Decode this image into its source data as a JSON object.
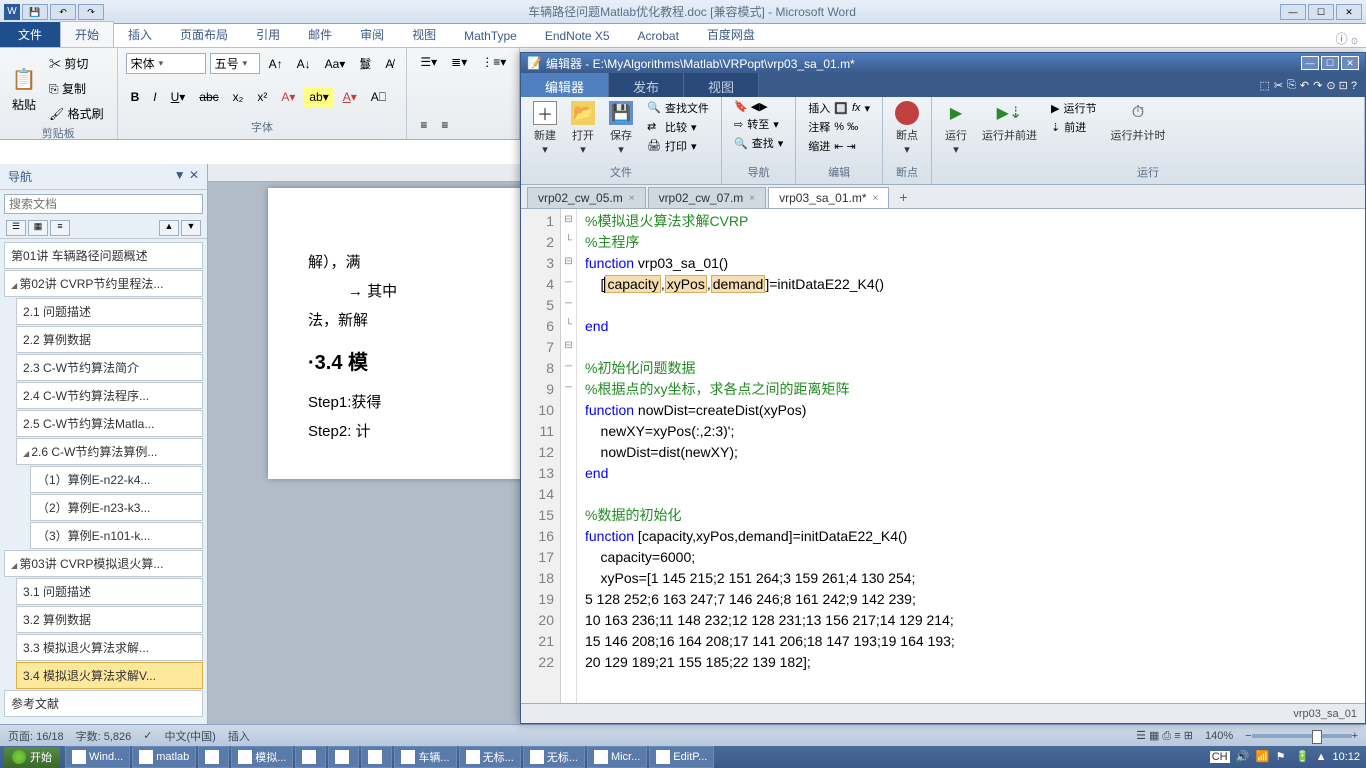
{
  "word": {
    "title": "车辆路径问题Matlab优化教程.doc [兼容模式] - Microsoft Word",
    "tabs": {
      "file": "文件",
      "home": "开始",
      "insert": "插入",
      "layout": "页面布局",
      "ref": "引用",
      "mail": "邮件",
      "review": "审阅",
      "view": "视图",
      "mathtype": "MathType",
      "endnote": "EndNote X5",
      "acrobat": "Acrobat",
      "baidu": "百度网盘"
    },
    "ribbon": {
      "clipboard": {
        "paste": "粘贴",
        "cut": "剪切",
        "copy": "复制",
        "format_painter": "格式刷",
        "label": "剪贴板"
      },
      "font": {
        "name": "宋体",
        "size": "五号",
        "label": "字体"
      }
    },
    "nav": {
      "title": "导航",
      "search_placeholder": "搜索文档",
      "items": [
        {
          "text": "第01讲 车辆路径问题概述",
          "indent": 0
        },
        {
          "text": "第02讲 CVRP节约里程法...",
          "indent": 0,
          "expand": true
        },
        {
          "text": "2.1 问题描述",
          "indent": 1
        },
        {
          "text": "2.2 算例数据",
          "indent": 1
        },
        {
          "text": "2.3 C-W节约算法简介",
          "indent": 1
        },
        {
          "text": "2.4 C-W节约算法程序...",
          "indent": 1
        },
        {
          "text": "2.5 C-W节约算法Matla...",
          "indent": 1
        },
        {
          "text": "2.6 C-W节约算法算例...",
          "indent": 1,
          "expand": true
        },
        {
          "text": "（1）算例E-n22-k4...",
          "indent": 2
        },
        {
          "text": "（2）算例E-n23-k3...",
          "indent": 2
        },
        {
          "text": "（3）算例E-n101-k...",
          "indent": 2
        },
        {
          "text": "第03讲 CVRP模拟退火算...",
          "indent": 0,
          "expand": true
        },
        {
          "text": "3.1 问题描述",
          "indent": 1
        },
        {
          "text": "3.2 算例数据",
          "indent": 1
        },
        {
          "text": "3.3 模拟退火算法求解...",
          "indent": 1
        },
        {
          "text": "3.4 模拟退火算法求解V...",
          "indent": 1,
          "active": true
        },
        {
          "text": "参考文献",
          "indent": 0
        }
      ]
    },
    "doc": {
      "step_label": "Step",
      "line1": "解），满",
      "line2a": "→ 其中",
      "line3": "法，新解",
      "heading": "·3.4 模",
      "step1": "Step1:获得",
      "step2": "Step2:  计"
    },
    "statusbar": {
      "page": "页面: 16/18",
      "words": "字数: 5,826",
      "lang": "中文(中国)",
      "insert": "插入",
      "zoom": "140%"
    }
  },
  "matlab": {
    "title": "编辑器 - E:\\MyAlgorithms\\Matlab\\VRPopt\\vrp03_sa_01.m*",
    "tabs": {
      "editor": "编辑器",
      "publish": "发布",
      "view": "视图"
    },
    "toolstrip": {
      "file": {
        "new": "新建",
        "open": "打开",
        "save": "保存",
        "find_files": "查找文件",
        "compare": "比较",
        "print": "打印",
        "label": "文件"
      },
      "nav": {
        "insert": "插入",
        "comment": "注释",
        "indent": "缩进",
        "goto": "转至",
        "find": "查找",
        "fx": "fx",
        "label": "导航"
      },
      "edit": {
        "label": "编辑"
      },
      "bp": {
        "breakpoints": "断点",
        "label": "断点"
      },
      "run": {
        "run": "运行",
        "run_advance": "运行并前进",
        "run_section": "运行节",
        "advance": "前进",
        "run_time": "运行并计时",
        "label": "运行"
      }
    },
    "filetabs": [
      {
        "name": "vrp02_cw_05.m"
      },
      {
        "name": "vrp02_cw_07.m"
      },
      {
        "name": "vrp03_sa_01.m*",
        "active": true
      }
    ],
    "code_lines": [
      "1",
      "2",
      "3",
      "4",
      "5",
      "6",
      "7",
      "8",
      "9",
      "10",
      "11",
      "12",
      "13",
      "14",
      "15",
      "16",
      "17",
      "18",
      "19",
      "20",
      "21",
      "22"
    ],
    "code": {
      "c1": "%模拟退火算法求解CVRP",
      "c2": "%主程序",
      "k3": "function",
      "f3": " vrp03_sa_01()",
      "l4a": "    [",
      "l4b": "capacity",
      "l4c": ",",
      "l4d": "xyPos",
      "l4e": ",",
      "l4f": "demand",
      "l4g": "]=initDataE22_K4()",
      "k6": "end",
      "c8": "%初始化问题数据",
      "c9": "%根据点的xy坐标，求各点之间的距离矩阵",
      "k10": "function",
      "f10": " nowDist=createDist(xyPos)",
      "l11": "    newXY=xyPos(:,2:3)';",
      "l12": "    nowDist=dist(newXY);",
      "k13": "end",
      "c15": "%数据的初始化",
      "k16": "function",
      "f16": " [capacity,xyPos,demand]=initDataE22_K4()",
      "l17": "    capacity=6000;",
      "l18": "    xyPos=[1 145 215;2 151 264;3 159 261;4 130 254;",
      "l19": "5 128 252;6 163 247;7 146 246;8 161 242;9 142 239;",
      "l20": "10 163 236;11 148 232;12 128 231;13 156 217;14 129 214;",
      "l21": "15 146 208;16 164 208;17 141 206;18 147 193;19 164 193;",
      "l22": "20 129 189;21 155 185;22 139 182];"
    },
    "statusbar": {
      "file": "vrp03_sa_01"
    }
  },
  "taskbar": {
    "start": "开始",
    "items": [
      "Wind...",
      "matlab",
      "",
      "模拟...",
      "",
      "",
      "",
      "车辆...",
      "无标...",
      "无标...",
      "Micr...",
      "EditP..."
    ],
    "ime": "CH",
    "time": "10:12",
    "date": "▲"
  }
}
